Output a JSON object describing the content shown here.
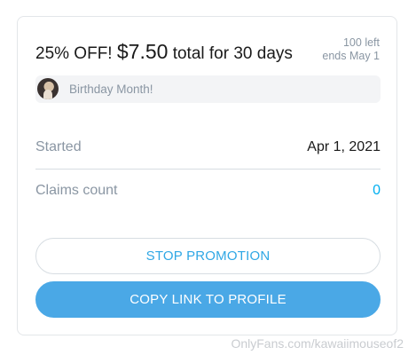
{
  "promotion": {
    "discount": "25% OFF!",
    "price": "$7.50",
    "duration": "total for 30 days",
    "left": "100 left",
    "ends": "ends May 1",
    "message": "Birthday Month!"
  },
  "details": {
    "started_label": "Started",
    "started_value": "Apr 1, 2021",
    "claims_label": "Claims count",
    "claims_value": "0"
  },
  "actions": {
    "stop_label": "STOP PROMOTION",
    "copy_label": "COPY LINK TO PROFILE"
  },
  "watermark": "OnlyFans.com/kawaiimouseof2",
  "colors": {
    "accent": "#00aff0",
    "button_fill": "#4aa8e6",
    "muted_text": "#8a96a3"
  }
}
